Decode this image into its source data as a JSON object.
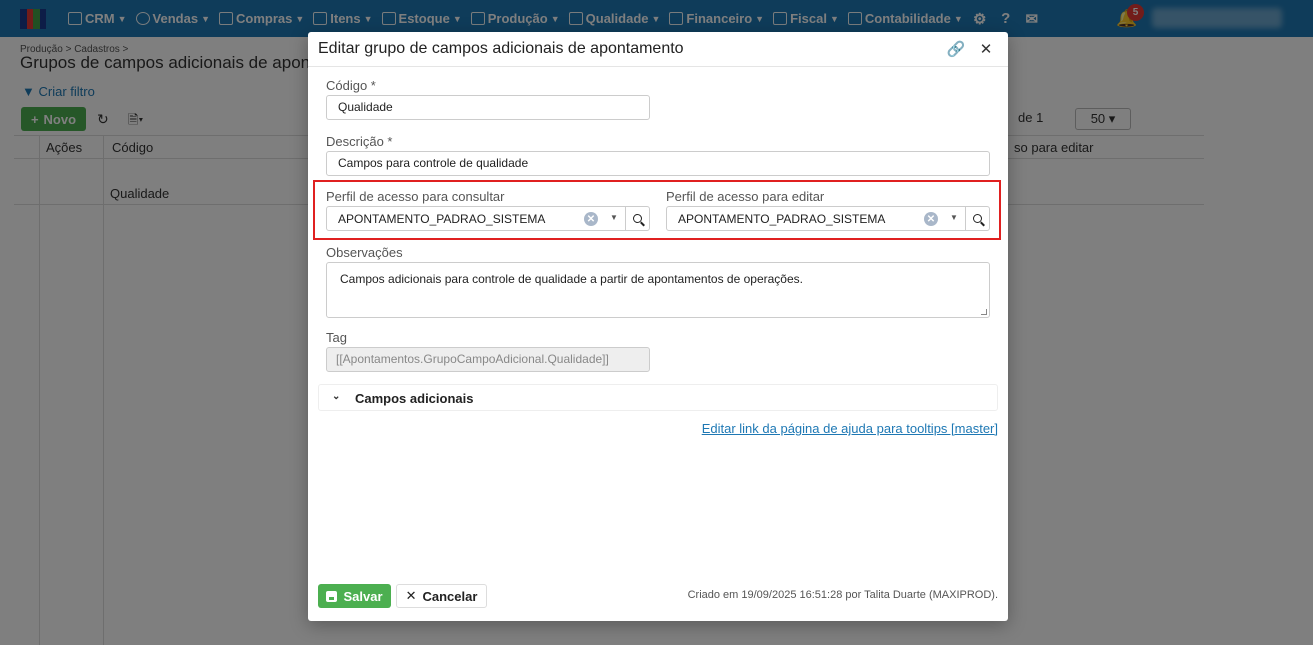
{
  "topbar": {
    "nav": [
      {
        "label": "CRM",
        "icon": "crm-icon"
      },
      {
        "label": "Vendas",
        "icon": "dollar-icon"
      },
      {
        "label": "Compras",
        "icon": "cart-icon"
      },
      {
        "label": "Itens",
        "icon": "items-icon"
      },
      {
        "label": "Estoque",
        "icon": "stock-icon"
      },
      {
        "label": "Produção",
        "icon": "factory-icon"
      },
      {
        "label": "Qualidade",
        "icon": "checklist-icon"
      },
      {
        "label": "Financeiro",
        "icon": "money-bag-icon"
      },
      {
        "label": "Fiscal",
        "icon": "document-icon"
      },
      {
        "label": "Contabilidade",
        "icon": "calculator-icon"
      }
    ],
    "notifications_count": "5"
  },
  "page": {
    "breadcrumb": "Produção > Cadastros >",
    "title": "Grupos de campos adicionais de apontamento",
    "filter_link": "Criar filtro",
    "new_button": "Novo",
    "pager_text": "de 1",
    "page_size": "50",
    "columns": {
      "actions": "Ações",
      "code": "Código",
      "edit_profile": "so para editar"
    },
    "rows": [
      {
        "code": "Qualidade"
      }
    ]
  },
  "modal": {
    "title": "Editar grupo de campos adicionais de apontamento",
    "codigo_label": "Código *",
    "codigo_value": "Qualidade",
    "descricao_label": "Descrição *",
    "descricao_value": "Campos para controle de qualidade",
    "perfil_consultar_label": "Perfil de acesso para consultar",
    "perfil_consultar_value": "APONTAMENTO_PADRAO_SISTEMA",
    "perfil_editar_label": "Perfil de acesso para editar",
    "perfil_editar_value": "APONTAMENTO_PADRAO_SISTEMA",
    "observacoes_label": "Observações",
    "observacoes_value": "Campos adicionais para controle de qualidade a partir de apontamentos de operações.",
    "tag_label": "Tag",
    "tag_value": "[[Apontamentos.GrupoCampoAdicional.Qualidade]]",
    "accordion_label": "Campos adicionais",
    "help_link": "Editar link da página de ajuda para tooltips [master]",
    "save_button": "Salvar",
    "cancel_button": "Cancelar",
    "created_info": "Criado em 19/09/2025 16:51:28 por Talita Duarte (MAXIPROD)."
  },
  "colors": {
    "nav_bg": "#1e78b4",
    "primary_green": "#4caf50",
    "highlight_red": "#e02020",
    "badge_red": "#e53935"
  }
}
